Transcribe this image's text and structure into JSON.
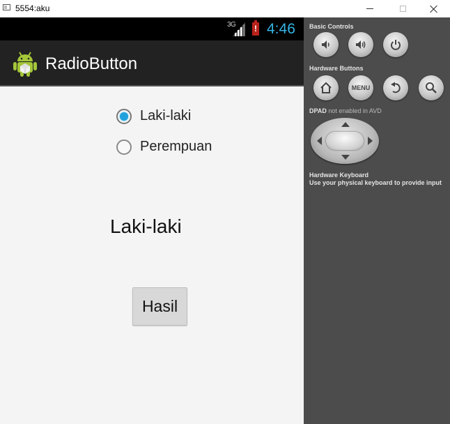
{
  "window": {
    "title": "5554:aku"
  },
  "status_bar": {
    "network": "3G",
    "battery_alert": "!",
    "time": "4:46"
  },
  "app": {
    "title": "RadioButton",
    "accent": "#33b5e5"
  },
  "radio_group": {
    "options": [
      {
        "label": "Laki-laki",
        "checked": true
      },
      {
        "label": "Perempuan",
        "checked": false
      }
    ]
  },
  "result_text": "Laki-laki",
  "submit_button": {
    "label": "Hasil"
  },
  "controls_panel": {
    "basic_controls": {
      "title": "Basic Controls",
      "buttons": [
        "volume-down-icon",
        "volume-up-icon",
        "power-icon"
      ]
    },
    "hardware_buttons": {
      "title": "Hardware Buttons",
      "buttons": [
        "home-icon",
        "MENU",
        "back-icon",
        "search-icon"
      ],
      "menu_label": "MENU"
    },
    "dpad": {
      "title": "DPAD",
      "note": "not enabled in AVD"
    },
    "keyboard": {
      "title": "Hardware Keyboard",
      "note": "Use your physical keyboard to provide input"
    }
  }
}
